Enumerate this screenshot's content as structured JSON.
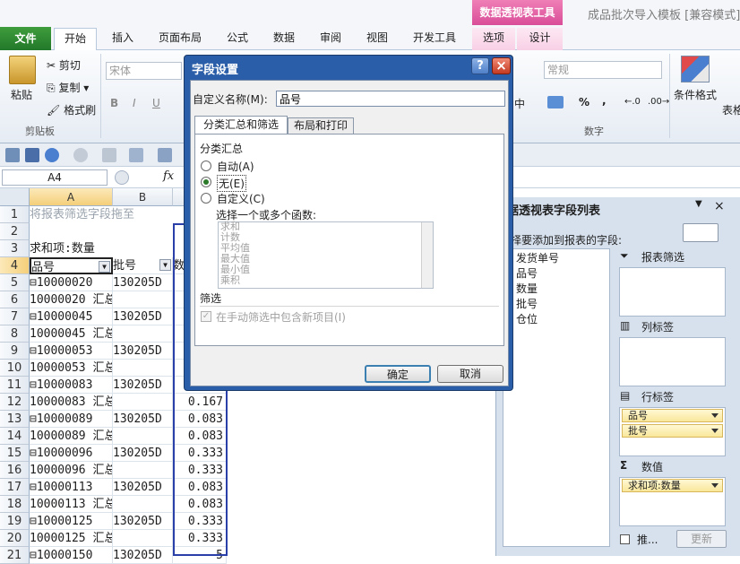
{
  "title_bar": {
    "context_header": "数据透视表工具",
    "document_title": "成品批次导入模板 [兼容模式]"
  },
  "tabs": {
    "file": "文件",
    "items": [
      "开始",
      "插入",
      "页面布局",
      "公式",
      "数据",
      "审阅",
      "视图",
      "开发工具"
    ],
    "context": [
      "选项",
      "设计"
    ]
  },
  "ribbon": {
    "paste": "粘贴",
    "cut": "剪切",
    "copy": "复制",
    "format_painter": "格式刷",
    "clipboard_group": "剪贴板",
    "font_name": "宋体",
    "number_format": "常规",
    "number_group": "数字",
    "conditional_format": "条件格式",
    "table_format": "表格",
    "align_fragment": "中",
    "percent": "%",
    "comma": ","
  },
  "formula_bar": {
    "name_box": "A4",
    "fx": "fx"
  },
  "columns": [
    "A",
    "B"
  ],
  "rows": [
    "1",
    "2",
    "3",
    "4",
    "5",
    "6",
    "7",
    "8",
    "9",
    "10",
    "11",
    "12",
    "13",
    "14",
    "15",
    "16",
    "17",
    "18",
    "19",
    "20",
    "21"
  ],
  "sheet": {
    "r1": "将报表筛选字段拖至",
    "r3": "求和项:数量",
    "hdr_a": "品号",
    "hdr_b": "批号",
    "hdr_c": "数",
    "data": [
      {
        "a": "⊟10000020",
        "b": "130205D",
        "c": ""
      },
      {
        "a": "10000020 汇总",
        "b": "",
        "c": ""
      },
      {
        "a": "⊟10000045",
        "b": "130205D",
        "c": ""
      },
      {
        "a": "10000045 汇总",
        "b": "",
        "c": ""
      },
      {
        "a": "⊟10000053",
        "b": "130205D",
        "c": ""
      },
      {
        "a": "10000053 汇总",
        "b": "",
        "c": ""
      },
      {
        "a": "⊟10000083",
        "b": "130205D",
        "c": ""
      },
      {
        "a": "10000083 汇总",
        "b": "",
        "c": "0.167"
      },
      {
        "a": "⊟10000089",
        "b": "130205D",
        "c": "0.083"
      },
      {
        "a": "10000089 汇总",
        "b": "",
        "c": "0.083"
      },
      {
        "a": "⊟10000096",
        "b": "130205D",
        "c": "0.333"
      },
      {
        "a": "10000096 汇总",
        "b": "",
        "c": "0.333"
      },
      {
        "a": "⊟10000113",
        "b": "130205D",
        "c": "0.083"
      },
      {
        "a": "10000113 汇总",
        "b": "",
        "c": "0.083"
      },
      {
        "a": "⊟10000125",
        "b": "130205D",
        "c": "0.333"
      },
      {
        "a": "10000125 汇总",
        "b": "",
        "c": "0.333"
      },
      {
        "a": "⊟10000150",
        "b": "130205D",
        "c": "5"
      }
    ]
  },
  "dialog": {
    "title": "字段设置",
    "help": "?",
    "close": "×",
    "name_label": "自定义名称(M):",
    "name_value": "品号",
    "tab1": "分类汇总和筛选",
    "tab2": "布局和打印",
    "subtotal_section": "分类汇总",
    "opt_auto": "自动(A)",
    "opt_none": "无(E)",
    "opt_custom": "自定义(C)",
    "func_label": "选择一个或多个函数:",
    "functions": [
      "求和",
      "计数",
      "平均值",
      "最大值",
      "最小值",
      "乘积"
    ],
    "filter_section": "筛选",
    "filter_option": "在手动筛选中包含新项目(I)",
    "ok": "确定",
    "cancel": "取消"
  },
  "field_list": {
    "title": "据透视表字段列表",
    "subtitle": "择要添加到报表的字段:",
    "fields": [
      "发货单号",
      "品号",
      "数量",
      "批号",
      "仓位"
    ],
    "report_filter": "报表筛选",
    "column_labels": "列标签",
    "row_labels": "行标签",
    "values": "数值",
    "row_chips": [
      "品号",
      "批号"
    ],
    "value_chip": "求和项:数量",
    "defer": "推...",
    "update": "更新"
  },
  "colors": {
    "accent": "#2a5ea8",
    "file_tab": "#2e8a32",
    "context": "#e065a7"
  }
}
